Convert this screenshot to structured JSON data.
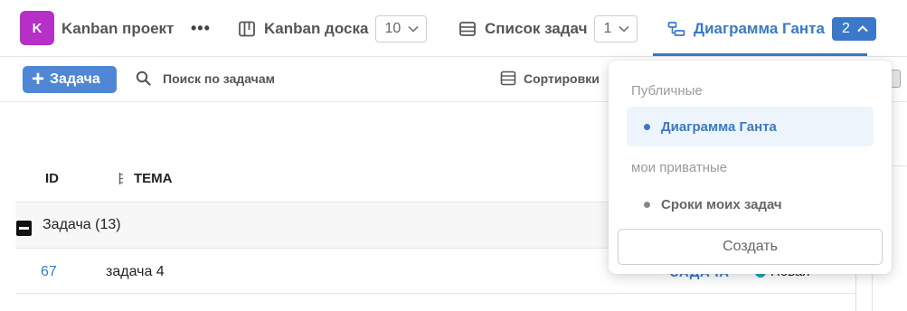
{
  "project": {
    "logo_letter": "K",
    "name": "Kanban проект",
    "more_label": "•••"
  },
  "nav": {
    "tabs": [
      {
        "label": "Kanban доска",
        "count": "10",
        "icon": "board-icon"
      },
      {
        "label": "Список задач",
        "count": "1",
        "icon": "list-icon"
      },
      {
        "label": "Диаграмма Ганта",
        "count": "2",
        "icon": "gantt-icon",
        "active": true
      }
    ]
  },
  "toolbar": {
    "add_task_label": "Задача",
    "search_placeholder": "Поиск по задачам",
    "sort_label": "Сортировки"
  },
  "table": {
    "columns": {
      "id": "ID",
      "subject": "ТЕМА"
    },
    "group": {
      "label": "Задача (13)"
    },
    "rows": [
      {
        "id": "67",
        "name": "задача 4",
        "type": "ЗАДАЧА",
        "status": "Новая"
      }
    ]
  },
  "dropdown": {
    "public_section": "Публичные",
    "public_items": [
      {
        "label": "Диаграмма Ганта",
        "selected": true
      }
    ],
    "private_section": "мои приватные",
    "private_items": [
      {
        "label": "Сроки моих задач"
      }
    ],
    "create_label": "Создать"
  },
  "colors": {
    "accent": "#3b78c9",
    "add_button": "#4f87d4",
    "logo": "#b62fc7",
    "status_new": "#1aa6b7"
  }
}
